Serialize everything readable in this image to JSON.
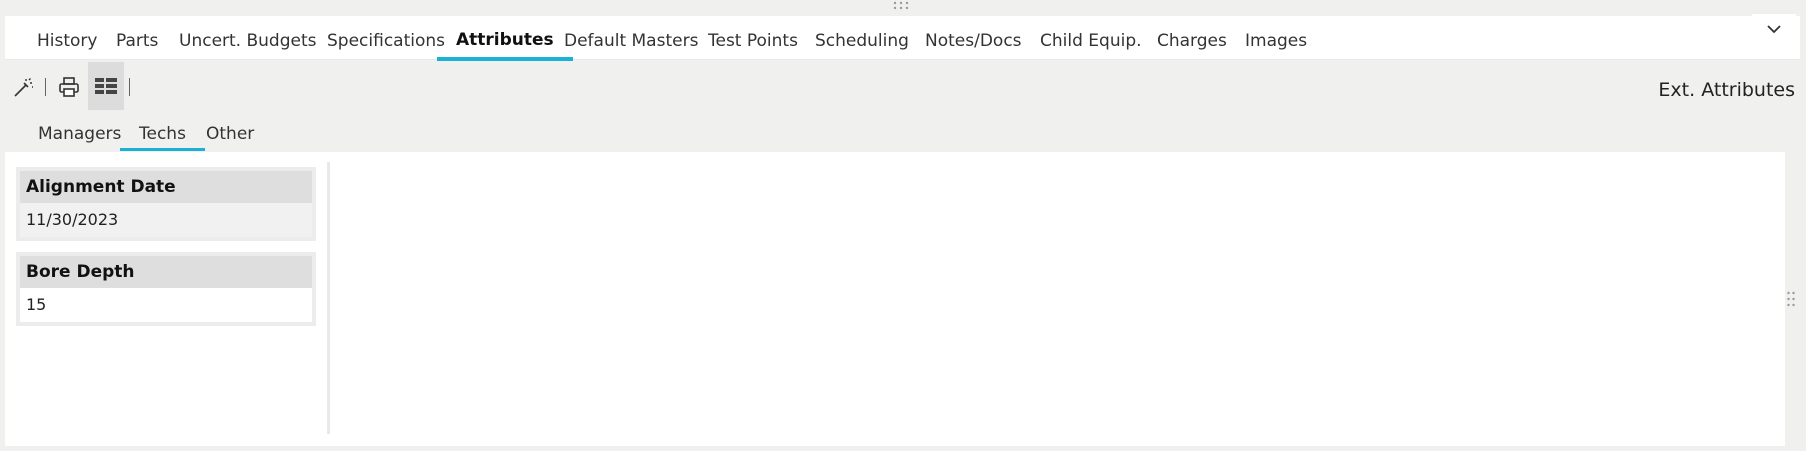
{
  "tabs": [
    {
      "label": "History"
    },
    {
      "label": "Parts"
    },
    {
      "label": "Uncert. Budgets"
    },
    {
      "label": "Specifications"
    },
    {
      "label": "Attributes",
      "active": true
    },
    {
      "label": "Default Masters"
    },
    {
      "label": "Test Points"
    },
    {
      "label": "Scheduling"
    },
    {
      "label": "Notes/Docs"
    },
    {
      "label": "Child Equip."
    },
    {
      "label": "Charges"
    },
    {
      "label": "Images"
    }
  ],
  "toolbar": {
    "icons": [
      "magic-wand-icon",
      "print-icon",
      "grid-view-icon"
    ],
    "title": "Ext. Attributes"
  },
  "subtabs": [
    {
      "label": "Managers"
    },
    {
      "label": "Techs",
      "active": true
    },
    {
      "label": "Other"
    }
  ],
  "attributes": [
    {
      "label": "Alignment Date",
      "value": "11/30/2023",
      "editable": false
    },
    {
      "label": "Bore Depth",
      "value": "15",
      "editable": true
    }
  ],
  "colors": {
    "accent": "#1ab0d8",
    "background": "#f0f0ef",
    "panel": "#ffffff"
  }
}
